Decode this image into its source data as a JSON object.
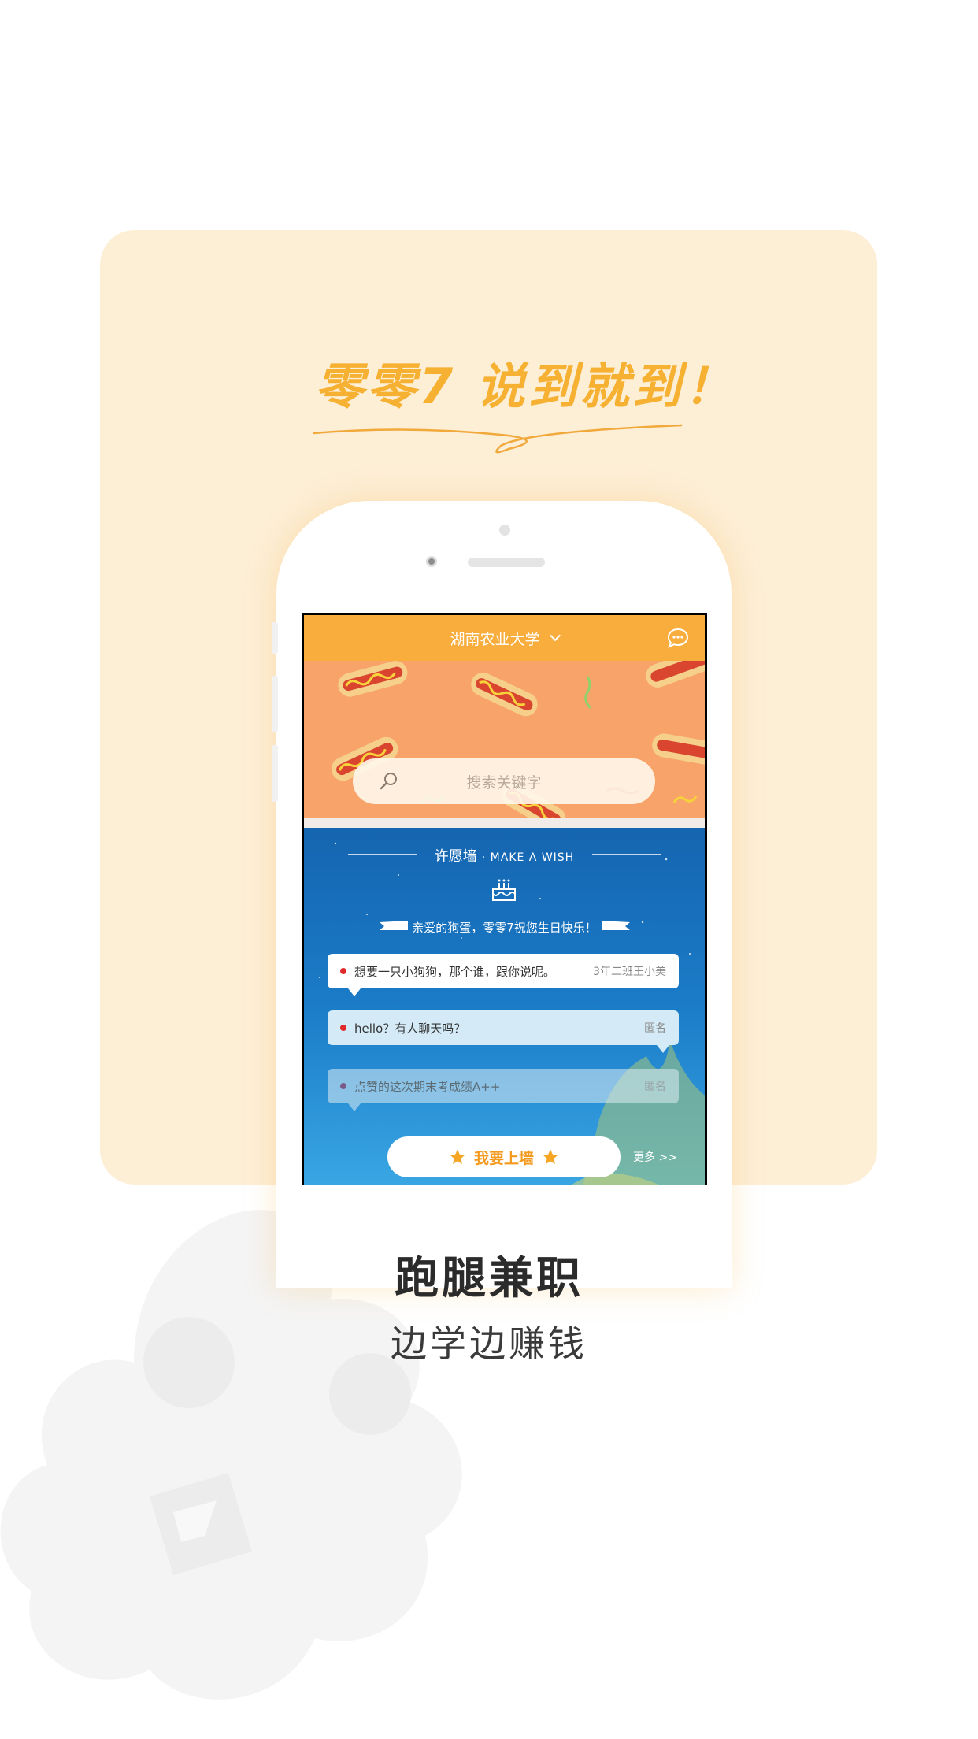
{
  "slogan": {
    "text": "零零7 说到就到！"
  },
  "app": {
    "nav_title": "湖南农业大学",
    "search_placeholder": "搜索关键字"
  },
  "wish_wall": {
    "title_cn": "许愿墙",
    "title_en": "· MAKE A WISH",
    "birthday_msg": "亲爱的狗蛋，零零7祝您生日快乐！",
    "messages": [
      {
        "text": "想要一只小狗狗，那个谁，跟你说呢。",
        "author": "3年二班王小美"
      },
      {
        "text": "hello？有人聊天吗？",
        "author": "匿名"
      },
      {
        "text": "点赞的这次期末考成绩A++",
        "author": "匿名"
      }
    ],
    "post_button": "我要上墙",
    "more_link": "更多 >>"
  },
  "caption": {
    "title": "跑腿兼职",
    "subtitle": "边学边赚钱"
  },
  "colors": {
    "card_bg": "#fdeed6",
    "accent_orange": "#f8ad3c",
    "banner_orange": "#f7a36a",
    "wish_blue": "#1b6eb7"
  },
  "icons": [
    "search-icon",
    "chat-icon",
    "cake-icon",
    "star-icon",
    "chevron-down-icon"
  ]
}
